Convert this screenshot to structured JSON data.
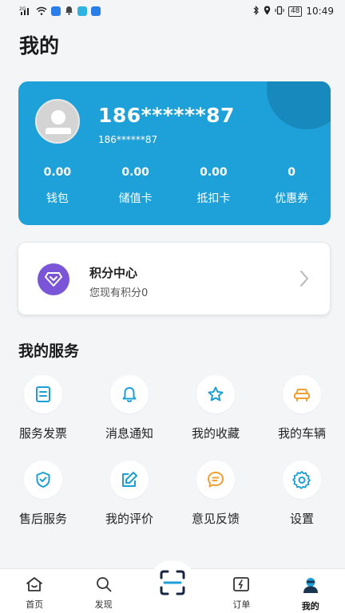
{
  "status_bar": {
    "time": "10:49",
    "battery": "48",
    "network": "2G"
  },
  "page": {
    "title": "我的"
  },
  "user": {
    "phone_main": "186******87",
    "phone_sub": "186******87",
    "stats": [
      {
        "value": "0.00",
        "label": "钱包",
        "name": "wallet"
      },
      {
        "value": "0.00",
        "label": "储值卡",
        "name": "stored-value-card"
      },
      {
        "value": "0.00",
        "label": "抵扣卡",
        "name": "deduction-card"
      },
      {
        "value": "0",
        "label": "优惠券",
        "name": "coupon"
      }
    ]
  },
  "points": {
    "title": "积分中心",
    "subtitle": "您现有积分0"
  },
  "services": {
    "title": "我的服务",
    "items": [
      {
        "label": "服务发票",
        "icon": "invoice-icon"
      },
      {
        "label": "消息通知",
        "icon": "bell-icon"
      },
      {
        "label": "我的收藏",
        "icon": "star-icon"
      },
      {
        "label": "我的车辆",
        "icon": "car-icon"
      },
      {
        "label": "售后服务",
        "icon": "shield-check-icon"
      },
      {
        "label": "我的评价",
        "icon": "edit-icon"
      },
      {
        "label": "意见反馈",
        "icon": "chat-bubble-icon"
      },
      {
        "label": "设置",
        "icon": "gear-icon"
      }
    ]
  },
  "tabbar": {
    "items": [
      {
        "label": "首页",
        "icon": "home-icon"
      },
      {
        "label": "发现",
        "icon": "search-icon"
      },
      {
        "label": "",
        "icon": "scan-icon"
      },
      {
        "label": "订单",
        "icon": "order-icon"
      },
      {
        "label": "我的",
        "icon": "profile-icon"
      }
    ]
  },
  "colors": {
    "accent": "#1ea0d8",
    "service_icon": "#1a9fd6",
    "points_purple": "#7a55d8",
    "background": "#f4f5f7"
  }
}
